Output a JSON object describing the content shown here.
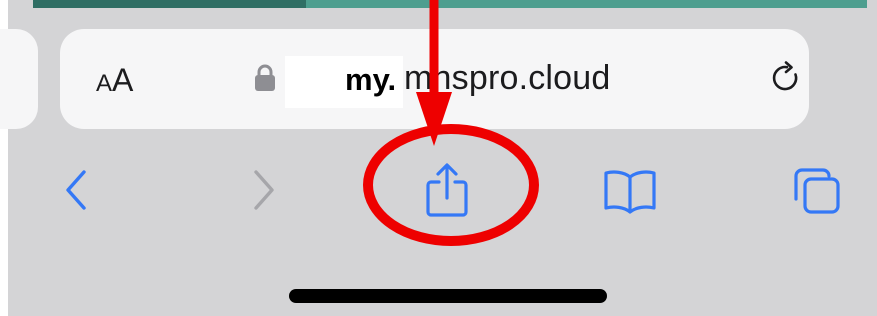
{
  "address_bar": {
    "reader_label_small": "A",
    "reader_label_large": "A",
    "url_text": "mhspro.cloud",
    "url_overlay_text": "my.",
    "lock_icon": "lock-icon",
    "reload_icon": "reload-icon"
  },
  "toolbar": {
    "items": [
      {
        "name": "back",
        "icon": "chevron-left-icon",
        "enabled": true
      },
      {
        "name": "forward",
        "icon": "chevron-right-icon",
        "enabled": false
      },
      {
        "name": "share",
        "icon": "share-icon",
        "enabled": true,
        "highlighted": true
      },
      {
        "name": "bookmarks",
        "icon": "book-icon",
        "enabled": true
      },
      {
        "name": "tabs",
        "icon": "tabs-icon",
        "enabled": true
      }
    ]
  },
  "annotation": {
    "color": "#ee0000",
    "type": "arrow-and-circle",
    "target": "share"
  },
  "colors": {
    "toolbar_bg": "#d4d4d6",
    "address_bar_bg": "#f6f6f7",
    "accent_blue": "#3478f6",
    "disabled_grey": "#a6a6aa",
    "page_strip": "#4d9e8f"
  }
}
